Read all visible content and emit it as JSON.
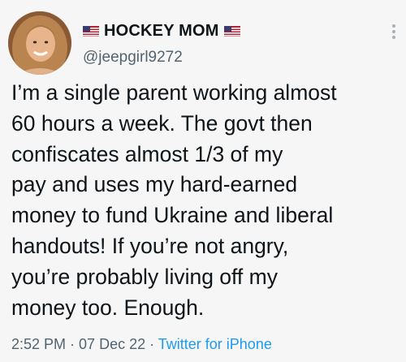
{
  "tweet": {
    "display_name": "HOCKEY MOM",
    "handle": "@jeepgirl9272",
    "flag_icon": "us-flag-icon",
    "more_icon": "more-options-icon",
    "body_lines": [
      "I’m a single parent working almost",
      "60 hours a week. The govt then",
      "confiscates almost 1/3 of my",
      "pay and uses my hard-earned",
      "money to fund Ukraine and liberal",
      "handouts!  If you’re not angry,",
      "you’re probably living off my",
      "money too.  Enough."
    ],
    "time": "2:52 PM",
    "separator": " · ",
    "date": "07 Dec 22",
    "source": "Twitter for iPhone"
  },
  "colors": {
    "background": "#f5f6f5",
    "text": "#0f1419",
    "secondary": "#536471",
    "link": "#1d9bf0"
  }
}
